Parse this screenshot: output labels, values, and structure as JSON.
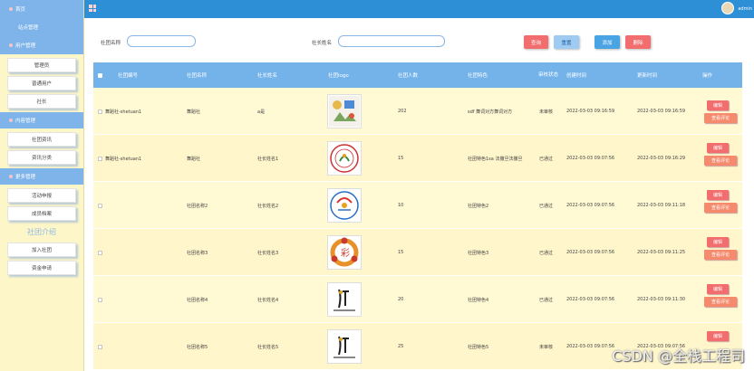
{
  "sidebar": {
    "home": "首页",
    "site_mgmt": "站点管理",
    "user_mgmt": "用户管理",
    "user_items": [
      "管理员",
      "普通用户",
      "社长"
    ],
    "content_mgmt": "内容管理",
    "content_items": [
      "社团资讯",
      "资讯分类"
    ],
    "more_mgmt": "更多管理",
    "more_items": [
      "活动申报",
      "成员档案"
    ],
    "club_intro": "社团介绍",
    "other_items": [
      "加入社团",
      "资金申请"
    ]
  },
  "topbar": {
    "username": "admin"
  },
  "search": {
    "club_name_label": "社团名称",
    "leader_name_label": "社长姓名",
    "query_btn": "查询",
    "reset_btn": "重置",
    "add_btn": "添加",
    "delete_btn": "删除"
  },
  "table": {
    "headers": [
      "社团编号",
      "社团名称",
      "社长姓名",
      "社团logo",
      "社团人数",
      "社团特色",
      "审核状态",
      "创建时间",
      "更新时间",
      "操作"
    ],
    "rows": [
      {
        "id": "舞蹈社-shetuan1",
        "name": "舞蹈社",
        "leader": "a是",
        "count": "202",
        "feature": "sdf 舞词对方舞词对方",
        "status": "未审核",
        "created": "2022-03-03 09:16:59",
        "updated": "2022-03-03 09:16:59",
        "ops": [
          "编辑",
          "查看评论"
        ]
      },
      {
        "id": "舞蹈社-shetuan1",
        "name": "舞蹈社",
        "leader": "社长姓名1",
        "count": "15",
        "feature": "社团特色1sa 法撒旦法撒旦",
        "status": "已通过",
        "created": "2022-03-03 09:07:56",
        "updated": "2022-03-03 09:16:29",
        "ops": [
          "编辑",
          "查看评论"
        ]
      },
      {
        "id": "",
        "name": "社团名称2",
        "leader": "社长姓名2",
        "count": "10",
        "feature": "社团特色2",
        "status": "已通过",
        "created": "2022-03-03 09:07:56",
        "updated": "2022-03-03 09:11:18",
        "ops": [
          "编辑",
          "查看评论"
        ]
      },
      {
        "id": "",
        "name": "社团名称3",
        "leader": "社长姓名3",
        "count": "15",
        "feature": "社团特色3",
        "status": "已通过",
        "created": "2022-03-03 09:07:56",
        "updated": "2022-03-03 09:11:25",
        "ops": [
          "编辑",
          "查看评论"
        ]
      },
      {
        "id": "",
        "name": "社团名称4",
        "leader": "社长姓名4",
        "count": "20",
        "feature": "社团特色4",
        "status": "已通过",
        "created": "2022-03-03 09:07:56",
        "updated": "2022-03-03 09:11:30",
        "ops": [
          "编辑",
          "查看评论"
        ]
      },
      {
        "id": "",
        "name": "社团名称5",
        "leader": "社长姓名5",
        "count": "25",
        "feature": "社团特色5",
        "status": "未审核",
        "created": "2022-03-03 09:07:56",
        "updated": "2022-03-03 09:07:56",
        "ops": [
          "编辑",
          "查看评论"
        ]
      }
    ]
  },
  "watermark": "CSDN @全栈工程司"
}
